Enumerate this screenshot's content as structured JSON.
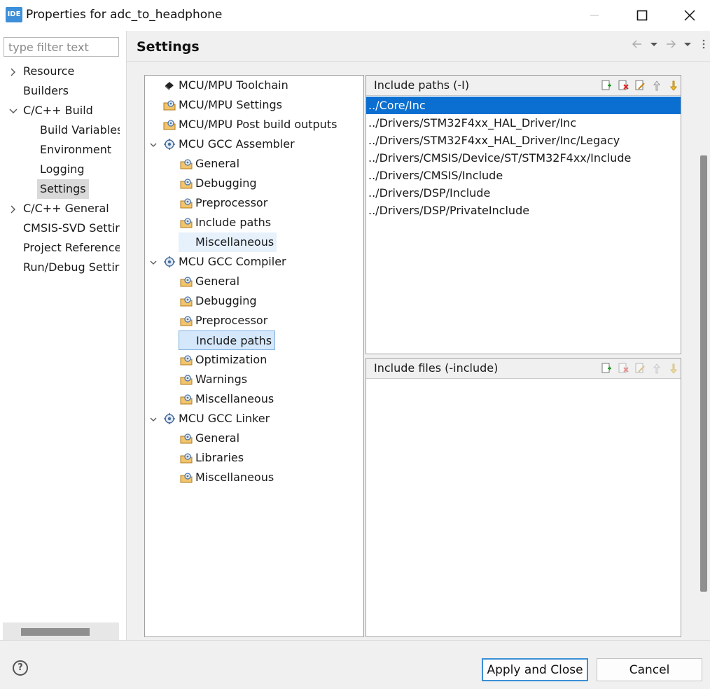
{
  "window": {
    "app_icon_text": "IDE",
    "title": "Properties for adc_to_headphone"
  },
  "nav": {
    "filter_placeholder": "type filter text",
    "items": [
      {
        "label": "Resource",
        "expandable": true,
        "expanded": false
      },
      {
        "label": "Builders"
      },
      {
        "label": "C/C++ Build",
        "expandable": true,
        "expanded": true
      },
      {
        "label": "Build Variables"
      },
      {
        "label": "Environment"
      },
      {
        "label": "Logging"
      },
      {
        "label": "Settings",
        "selected": true
      },
      {
        "label": "C/C++ General",
        "expandable": true,
        "expanded": false
      },
      {
        "label": "CMSIS-SVD Settir"
      },
      {
        "label": "Project Reference:"
      },
      {
        "label": "Run/Debug Settir"
      }
    ]
  },
  "page": {
    "title": "Settings"
  },
  "tool_tree": {
    "items": [
      {
        "label": "MCU/MPU Toolchain",
        "icon": "chip-icon"
      },
      {
        "label": "MCU/MPU Settings",
        "icon": "folder-gear-icon"
      },
      {
        "label": "MCU/MPU Post build outputs",
        "icon": "folder-gear-icon"
      },
      {
        "label": "MCU GCC Assembler",
        "icon": "gear-icon",
        "expanded": true
      },
      {
        "label": "General",
        "icon": "folder-gear-icon"
      },
      {
        "label": "Debugging",
        "icon": "folder-gear-icon"
      },
      {
        "label": "Preprocessor",
        "icon": "folder-gear-icon"
      },
      {
        "label": "Include paths",
        "icon": "folder-gear-icon"
      },
      {
        "label": "Miscellaneous",
        "icon": "folder-gear-icon",
        "hovered": true
      },
      {
        "label": "MCU GCC Compiler",
        "icon": "gear-icon",
        "expanded": true
      },
      {
        "label": "General",
        "icon": "folder-gear-icon"
      },
      {
        "label": "Debugging",
        "icon": "folder-gear-icon"
      },
      {
        "label": "Preprocessor",
        "icon": "folder-gear-icon"
      },
      {
        "label": "Include paths",
        "icon": "folder-gear-icon",
        "selected": true
      },
      {
        "label": "Optimization",
        "icon": "folder-gear-icon"
      },
      {
        "label": "Warnings",
        "icon": "folder-gear-icon"
      },
      {
        "label": "Miscellaneous",
        "icon": "folder-gear-icon"
      },
      {
        "label": "MCU GCC Linker",
        "icon": "gear-icon",
        "expanded": true
      },
      {
        "label": "General",
        "icon": "folder-gear-icon"
      },
      {
        "label": "Libraries",
        "icon": "folder-gear-icon"
      },
      {
        "label": "Miscellaneous",
        "icon": "folder-gear-icon"
      }
    ]
  },
  "include_paths": {
    "title": "Include paths (-I)",
    "paths": [
      "../Core/Inc",
      "../Drivers/STM32F4xx_HAL_Driver/Inc",
      "../Drivers/STM32F4xx_HAL_Driver/Inc/Legacy",
      "../Drivers/CMSIS/Device/ST/STM32F4xx/Include",
      "../Drivers/CMSIS/Include",
      "../Drivers/DSP/Include",
      "../Drivers/DSP/PrivateInclude"
    ],
    "selected_index": 0
  },
  "include_files": {
    "title": "Include files (-include)",
    "files": []
  },
  "buttons": {
    "apply_close": "Apply and Close",
    "cancel": "Cancel",
    "help_glyph": "?"
  },
  "colors": {
    "selection_blue": "#0a6fd1",
    "tree_selection": "#d5e8fb",
    "window_bg": "#f0f0f0"
  }
}
